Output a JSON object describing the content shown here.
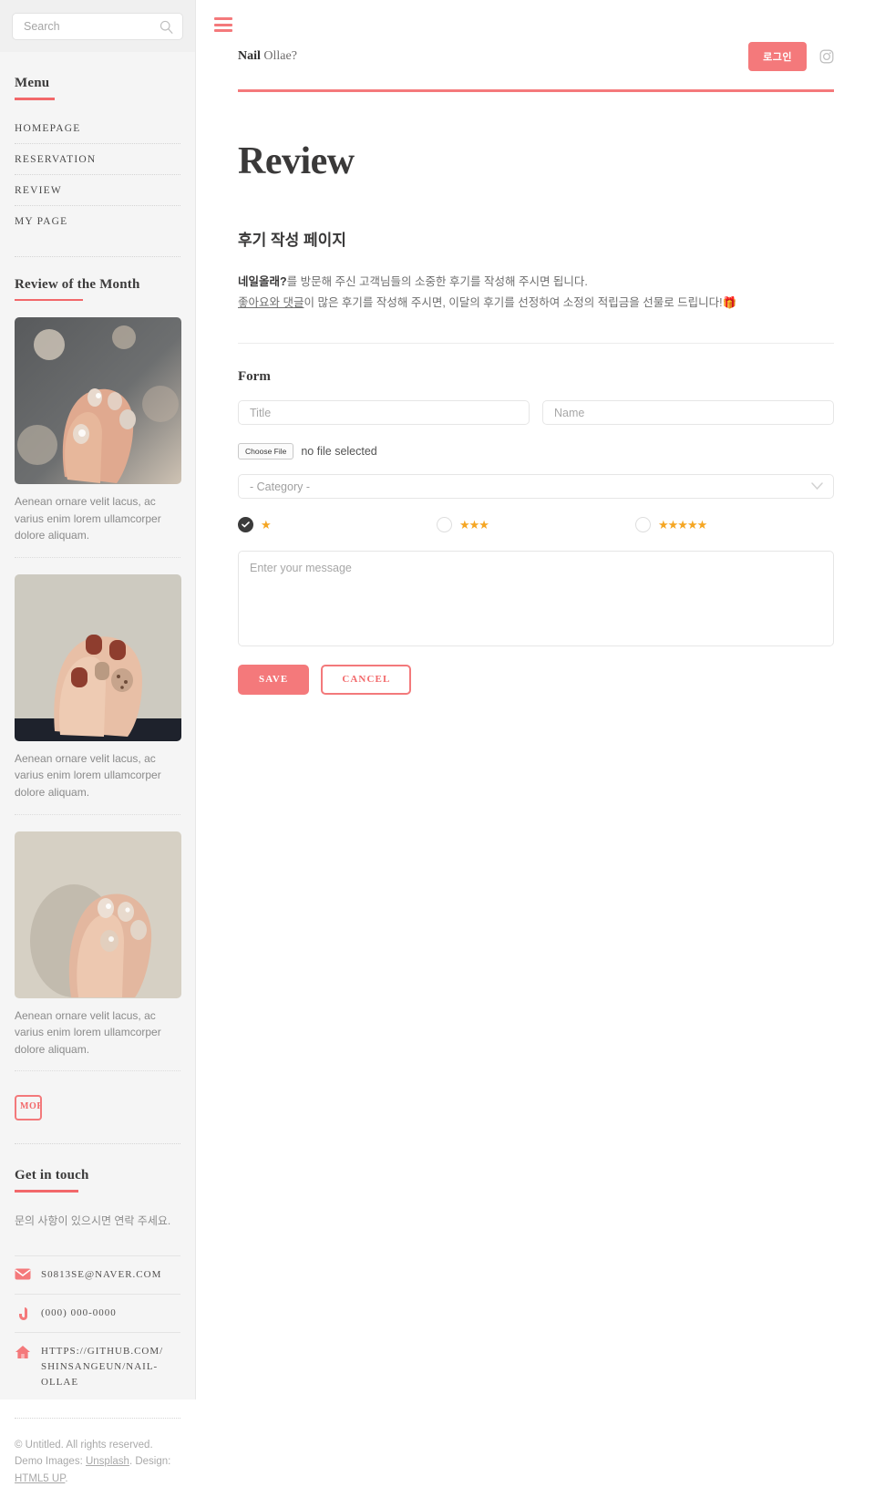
{
  "sidebar": {
    "search": {
      "placeholder": "Search",
      "value": "",
      "icon": "search-icon"
    },
    "menu_heading": "Menu",
    "menu_items": [
      {
        "label": "HOMEPAGE"
      },
      {
        "label": "RESERVATION"
      },
      {
        "label": "REVIEW"
      },
      {
        "label": "MY PAGE"
      }
    ],
    "month_heading": "Review of the Month",
    "reviews": [
      {
        "caption": "Aenean ornare velit lacus, ac varius enim lorem ullamcorper dolore aliquam."
      },
      {
        "caption": "Aenean ornare velit lacus, ac varius enim lorem ullamcorper dolore aliquam."
      },
      {
        "caption": "Aenean ornare velit lacus, ac varius enim lorem ullamcorper dolore aliquam."
      }
    ],
    "more_label": "MORE",
    "touch_heading": "Get in touch",
    "touch_desc": "문의 사항이 있으시면 연락 주세요.",
    "contacts": [
      {
        "icon": "envelope-icon",
        "text": "S0813SE@NAVER.COM"
      },
      {
        "icon": "phone-icon",
        "text": "(000) 000-0000"
      },
      {
        "icon": "home-icon",
        "text": "HTTPS://GITHUB.COM/ SHINSANGEUN/NAIL-OLLAE"
      }
    ],
    "footer": {
      "text_a": "© Untitled. All rights reserved. Demo Images: ",
      "link_a": "Unsplash",
      "text_b": ". Design: ",
      "link_b": "HTML5 UP",
      "text_c": "."
    }
  },
  "header": {
    "menu_icon": "hamburger-icon",
    "brand_bold": "Nail",
    "brand_rest": " Ollae?",
    "login_label": "로그인",
    "instagram_icon": "instagram-icon"
  },
  "main": {
    "title": "Review",
    "subtitle": "후기 작성 페이지",
    "intro_bold": "네일올래?",
    "intro_line1_rest": "를 방문해 주신 고객님들의 소중한 후기를 작성해 주시면 됩니다.",
    "intro_underline": "좋아요와 댓글",
    "intro_line2_rest": "이 많은 후기를 작성해 주시면, 이달의 후기를 선정하여 소정의 적립금을 선물로 드립니다!",
    "intro_emoji": "🎁",
    "form_title": "Form",
    "fields": {
      "title_placeholder": "Title",
      "title_value": "",
      "name_placeholder": "Name",
      "name_value": "",
      "choose_file_label": "Choose File",
      "file_status": "no file selected",
      "category_selected": "- Category -",
      "category_options": [
        "- Category -"
      ],
      "message_placeholder": "Enter your message",
      "message_value": ""
    },
    "ratings": [
      {
        "stars": "★",
        "checked": true
      },
      {
        "stars": "★★★",
        "checked": false
      },
      {
        "stars": "★★★★★",
        "checked": false
      }
    ],
    "save_label": "SAVE",
    "cancel_label": "CANCEL"
  },
  "colors": {
    "accent": "#f4797b",
    "accent_dark": "#f2686a",
    "sidebar_bg": "#f5f5f5",
    "text_dark": "#3a3939",
    "star": "#f5a623"
  }
}
